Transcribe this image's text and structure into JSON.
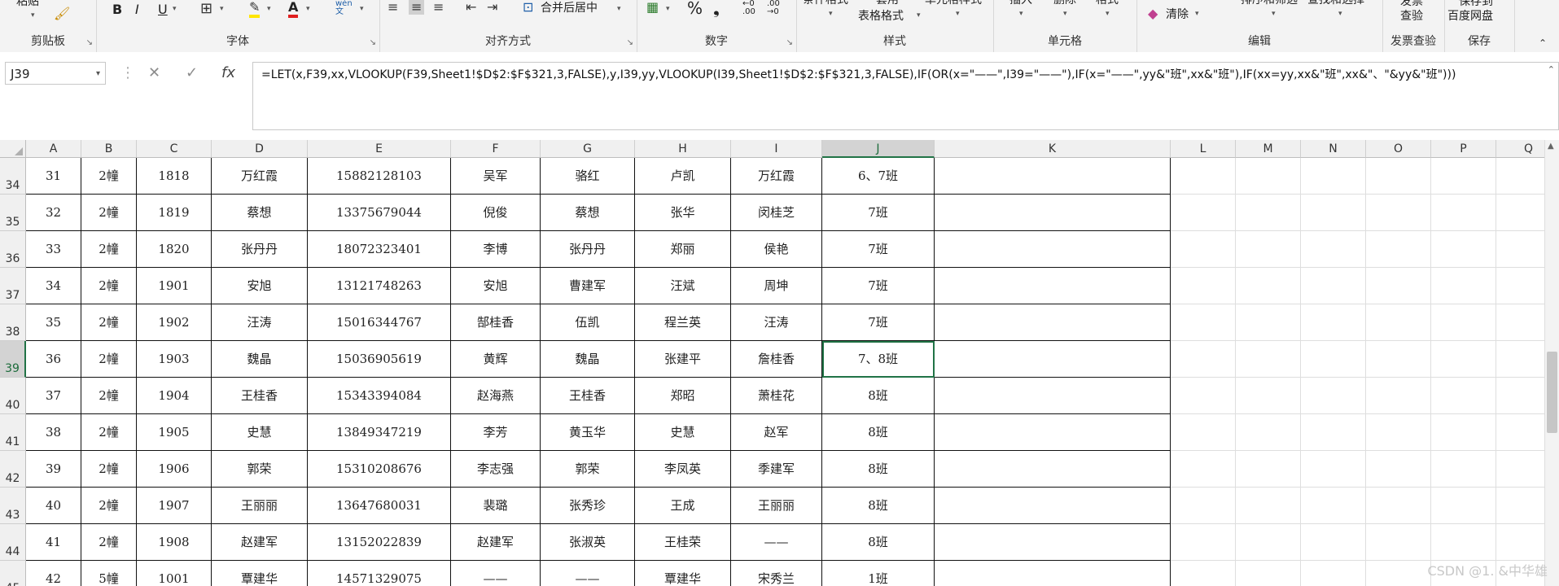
{
  "ribbon": {
    "groups": [
      {
        "label": "剪贴板",
        "buttons": [
          "粘贴"
        ]
      },
      {
        "label": "字体",
        "buttons": [
          "B",
          "I",
          "U"
        ]
      },
      {
        "label": "对齐方式",
        "buttons": [
          "合并后居中"
        ]
      },
      {
        "label": "数字",
        "buttons": [
          "%",
          "❟"
        ]
      },
      {
        "label": "样式",
        "buttons": [
          "条件格式",
          "套用",
          "表格格式",
          "单元格样式"
        ]
      },
      {
        "label": "单元格",
        "buttons": [
          "插入",
          "删除",
          "格式"
        ]
      },
      {
        "label": "编辑",
        "buttons": [
          "清除",
          "排序和筛选",
          "查找和选择"
        ]
      },
      {
        "label": "发票查验",
        "buttons": [
          "发票",
          "查验"
        ]
      },
      {
        "label": "保存",
        "buttons": [
          "保存到",
          "百度网盘"
        ]
      }
    ],
    "font_color": "#e02020",
    "fill_color": "#ffe600",
    "phonetic_label": "wén\n文"
  },
  "formula_bar": {
    "name_box": "J39",
    "formula": "=LET(x,F39,xx,VLOOKUP(F39,Sheet1!$D$2:$F$321,3,FALSE),y,I39,yy,VLOOKUP(I39,Sheet1!$D$2:$F$321,3,FALSE),IF(OR(x=\"——\",I39=\"——\"),IF(x=\"——\",yy&\"班\",xx&\"班\"),IF(xx=yy,xx&\"班\",xx&\"、\"&yy&\"班\")))",
    "cancel_icon": "✕",
    "enter_icon": "✓",
    "fx_label": "fx"
  },
  "columns": [
    "A",
    "B",
    "C",
    "D",
    "E",
    "F",
    "G",
    "H",
    "I",
    "J",
    "K",
    "L",
    "M",
    "N",
    "O",
    "P",
    "Q"
  ],
  "active_column": "J",
  "active_row": "39",
  "rows": [
    {
      "num": "34",
      "cells": [
        "31",
        "2幢",
        "1818",
        "万红霞",
        "15882128103",
        "吴军",
        "骆红",
        "卢凯",
        "万红霞",
        "6、7班"
      ]
    },
    {
      "num": "35",
      "cells": [
        "32",
        "2幢",
        "1819",
        "蔡想",
        "13375679044",
        "倪俊",
        "蔡想",
        "张华",
        "闵桂芝",
        "7班"
      ]
    },
    {
      "num": "36",
      "cells": [
        "33",
        "2幢",
        "1820",
        "张丹丹",
        "18072323401",
        "李博",
        "张丹丹",
        "郑丽",
        "侯艳",
        "7班"
      ]
    },
    {
      "num": "37",
      "cells": [
        "34",
        "2幢",
        "1901",
        "安旭",
        "13121748263",
        "安旭",
        "曹建军",
        "汪斌",
        "周坤",
        "7班"
      ]
    },
    {
      "num": "38",
      "cells": [
        "35",
        "2幢",
        "1902",
        "汪涛",
        "15016344767",
        "郜桂香",
        "伍凯",
        "程兰英",
        "汪涛",
        "7班"
      ]
    },
    {
      "num": "39",
      "cells": [
        "36",
        "2幢",
        "1903",
        "魏晶",
        "15036905619",
        "黄辉",
        "魏晶",
        "张建平",
        "詹桂香",
        "7、8班"
      ]
    },
    {
      "num": "40",
      "cells": [
        "37",
        "2幢",
        "1904",
        "王桂香",
        "15343394084",
        "赵海燕",
        "王桂香",
        "郑昭",
        "萧桂花",
        "8班"
      ]
    },
    {
      "num": "41",
      "cells": [
        "38",
        "2幢",
        "1905",
        "史慧",
        "13849347219",
        "李芳",
        "黄玉华",
        "史慧",
        "赵军",
        "8班"
      ]
    },
    {
      "num": "42",
      "cells": [
        "39",
        "2幢",
        "1906",
        "郭荣",
        "15310208676",
        "李志强",
        "郭荣",
        "李凤英",
        "季建军",
        "8班"
      ]
    },
    {
      "num": "43",
      "cells": [
        "40",
        "2幢",
        "1907",
        "王丽丽",
        "13647680031",
        "裴璐",
        "张秀珍",
        "王成",
        "王丽丽",
        "8班"
      ]
    },
    {
      "num": "44",
      "cells": [
        "41",
        "2幢",
        "1908",
        "赵建军",
        "13152022839",
        "赵建军",
        "张淑英",
        "王桂荣",
        "——",
        "8班"
      ]
    },
    {
      "num": "45",
      "cells": [
        "42",
        "5幢",
        "1001",
        "覃建华",
        "14571329075",
        "——",
        "——",
        "覃建华",
        "宋秀兰",
        "1班"
      ]
    }
  ],
  "watermark": "CSDN @1. &中华雄"
}
